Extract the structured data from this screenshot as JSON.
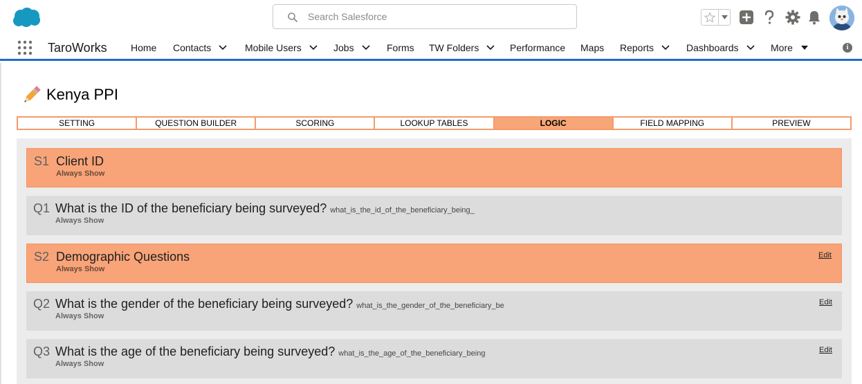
{
  "header": {
    "search_placeholder": "Search Salesforce"
  },
  "nav": {
    "app_name": "TaroWorks",
    "items": [
      {
        "label": "Home",
        "dropdown": false
      },
      {
        "label": "Contacts",
        "dropdown": true
      },
      {
        "label": "Mobile Users",
        "dropdown": true
      },
      {
        "label": "Jobs",
        "dropdown": true
      },
      {
        "label": "Forms",
        "dropdown": false
      },
      {
        "label": "TW Folders",
        "dropdown": true
      },
      {
        "label": "Performance",
        "dropdown": false
      },
      {
        "label": "Maps",
        "dropdown": false
      },
      {
        "label": "Reports",
        "dropdown": true
      },
      {
        "label": "Dashboards",
        "dropdown": true
      },
      {
        "label": "More",
        "dropdown": true
      }
    ],
    "accent_color": "#1b6fc6"
  },
  "page": {
    "title": "Kenya PPI"
  },
  "tabs": [
    {
      "label": "SETTING",
      "active": false
    },
    {
      "label": "QUESTION BUILDER",
      "active": false
    },
    {
      "label": "SCORING",
      "active": false
    },
    {
      "label": "LOOKUP TABLES",
      "active": false
    },
    {
      "label": "LOGIC",
      "active": true
    },
    {
      "label": "FIELD MAPPING",
      "active": false
    },
    {
      "label": "PREVIEW",
      "active": false
    }
  ],
  "logic_rows": [
    {
      "type": "section",
      "num": "S1",
      "title": "Client ID",
      "var": "",
      "sub": "Always Show",
      "edit": ""
    },
    {
      "type": "question",
      "num": "Q1",
      "title": "What is the ID of the beneficiary being surveyed?",
      "var": "what_is_the_id_of_the_beneficiary_being_",
      "sub": "Always Show",
      "edit": ""
    },
    {
      "type": "section",
      "num": "S2",
      "title": "Demographic Questions",
      "var": "",
      "sub": "Always Show",
      "edit": "Edit"
    },
    {
      "type": "question",
      "num": "Q2",
      "title": "What is the gender of the beneficiary being surveyed?",
      "var": "what_is_the_gender_of_the_beneficiary_be",
      "sub": "Always Show",
      "edit": "Edit"
    },
    {
      "type": "question",
      "num": "Q3",
      "title": "What is the age of the beneficiary being surveyed?",
      "var": "what_is_the_age_of_the_beneficiary_being",
      "sub": "Always Show",
      "edit": "Edit"
    }
  ],
  "colors": {
    "section_bg": "#f8a478",
    "tab_border": "#f59a6b",
    "question_bg": "#dcdcdc"
  }
}
